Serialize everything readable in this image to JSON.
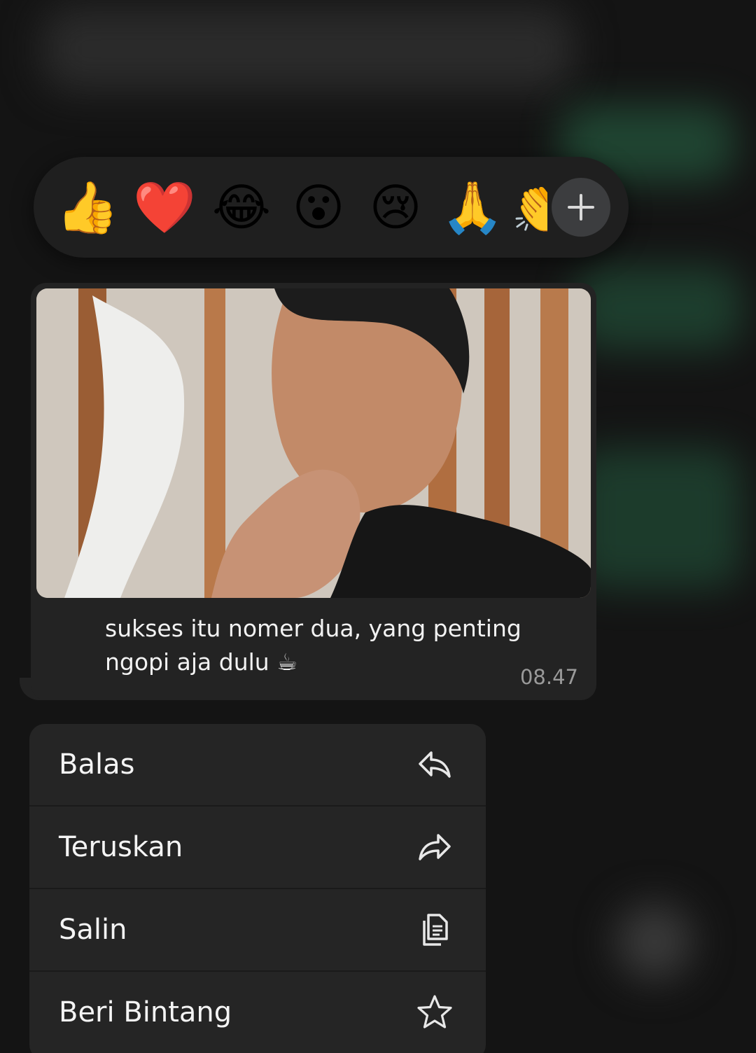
{
  "reactions": {
    "emojis": [
      "👍",
      "❤️",
      "😂",
      "😮",
      "😢",
      "🙏",
      "👏"
    ],
    "more_icon": "plus-icon"
  },
  "message": {
    "caption_line1": "sukses itu nomer dua, yang penting",
    "caption_line2": "ngopi aja dulu ☕",
    "time": "08.47"
  },
  "menu": {
    "items": [
      {
        "label": "Balas",
        "icon": "reply-icon"
      },
      {
        "label": "Teruskan",
        "icon": "forward-icon"
      },
      {
        "label": "Salin",
        "icon": "copy-icon"
      },
      {
        "label": "Beri Bintang",
        "icon": "star-icon"
      }
    ]
  },
  "colors": {
    "background": "#141414",
    "bubble": "#232323",
    "menu": "#252525",
    "reaction_bar": "#1f1f1f"
  }
}
